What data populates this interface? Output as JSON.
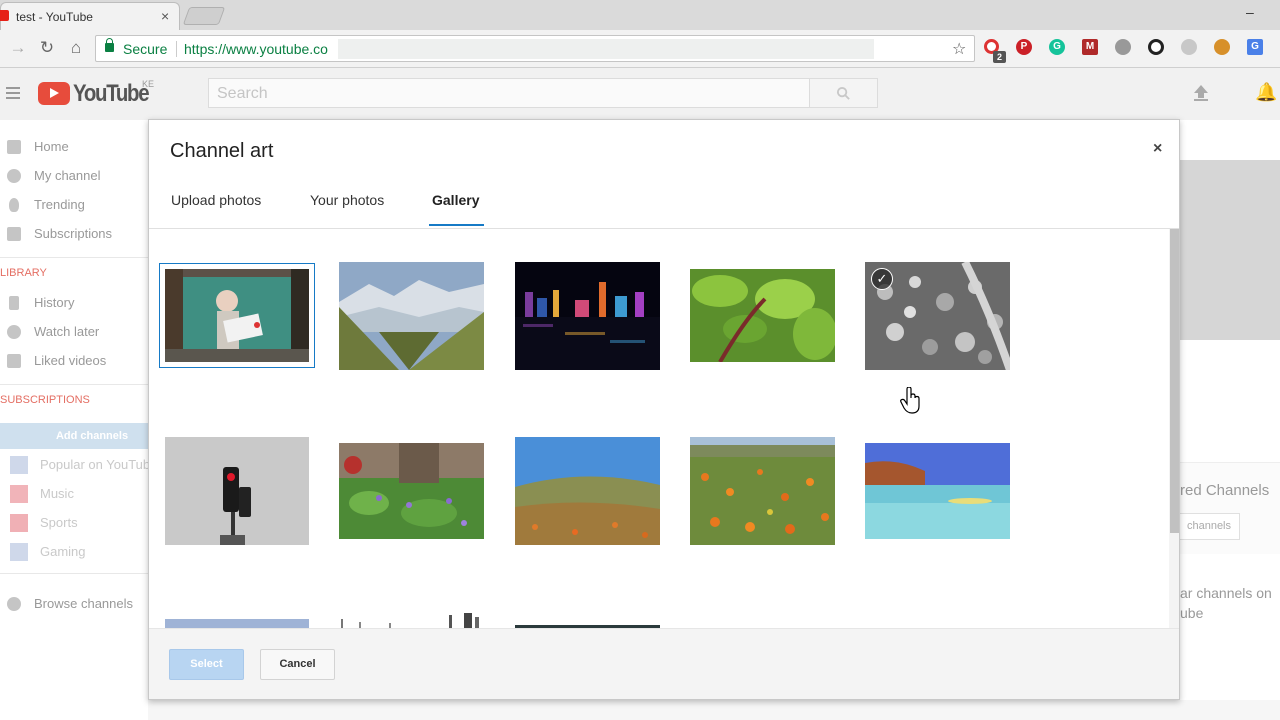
{
  "browser": {
    "tab_title": "test - YouTube",
    "tab_close": "×",
    "minimize": "–",
    "secure_label": "Secure",
    "url": "https://www.youtube.co",
    "ext_badge": "2"
  },
  "youtube": {
    "logo": "YouTube",
    "region": "KE",
    "search_placeholder": "Search",
    "sidebar": {
      "items": [
        {
          "label": "Home",
          "icon": "home-icon"
        },
        {
          "label": "My channel",
          "icon": "account-icon"
        },
        {
          "label": "Trending",
          "icon": "flame-icon"
        },
        {
          "label": "Subscriptions",
          "icon": "subscriptions-icon"
        }
      ],
      "library_header": "LIBRARY",
      "library": [
        {
          "label": "History",
          "icon": "hourglass-icon"
        },
        {
          "label": "Watch later",
          "icon": "clock-icon"
        },
        {
          "label": "Liked videos",
          "icon": "thumbs-up-icon"
        }
      ],
      "subscriptions_header": "SUBSCRIPTIONS",
      "add_channels": "Add channels",
      "subscriptions": [
        {
          "label": "Popular on YouTube",
          "color": "#cfd8ea"
        },
        {
          "label": "Music",
          "color": "#f1b4b9"
        },
        {
          "label": "Sports",
          "color": "#f0b0b5"
        },
        {
          "label": "Gaming",
          "color": "#cfd8ea"
        }
      ],
      "browse_channels": "Browse channels"
    },
    "right": {
      "featured_title": "red Channels",
      "channels_btn": "channels",
      "popular_line1": "ar channels on",
      "popular_line2": "ube"
    }
  },
  "dialog": {
    "title": "Channel art",
    "close": "×",
    "tabs": [
      "Upload photos",
      "Your photos",
      "Gallery"
    ],
    "active_tab": "Gallery",
    "select_label": "Select",
    "cancel_label": "Cancel",
    "check_mark": "✓",
    "accent_color": "#167ac6"
  },
  "gallery": [
    {
      "name": "girl-graffiti-photo"
    },
    {
      "name": "mountain-valley-photo"
    },
    {
      "name": "city-night-harbor-photo"
    },
    {
      "name": "green-leaves-photo"
    },
    {
      "name": "autumn-leaves-bw-photo",
      "checked": true
    },
    {
      "name": "traffic-light-photo"
    },
    {
      "name": "flower-garden-photo"
    },
    {
      "name": "hill-meadow-photo"
    },
    {
      "name": "poppy-field-photo"
    },
    {
      "name": "turquoise-lake-photo"
    }
  ]
}
